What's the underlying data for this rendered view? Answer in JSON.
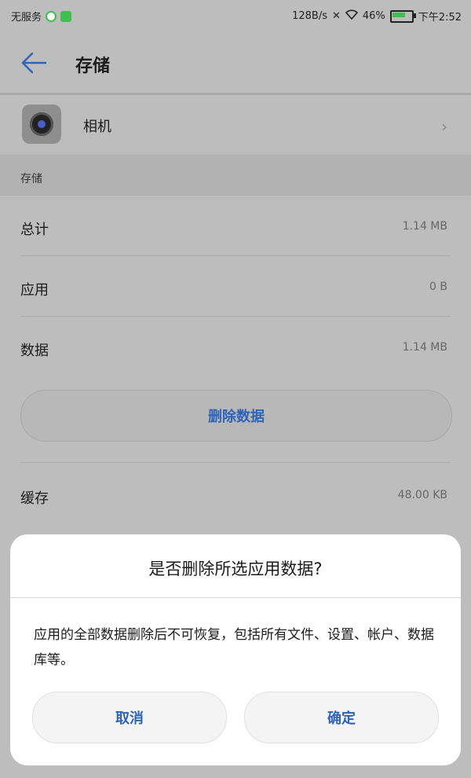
{
  "status_bar": {
    "carrier": "无服务",
    "speed": "128B/s",
    "battery_pct": "46%",
    "time": "下午2:52"
  },
  "header": {
    "title": "存储"
  },
  "app": {
    "name": "相机"
  },
  "storage": {
    "section_label": "存储",
    "rows": [
      {
        "label": "总计",
        "value": "1.14 MB"
      },
      {
        "label": "应用",
        "value": "0 B"
      },
      {
        "label": "数据",
        "value": "1.14 MB"
      }
    ],
    "delete_button": "删除数据",
    "cache_label": "缓存",
    "cache_value": "48.00 KB"
  },
  "dialog": {
    "title": "是否删除所选应用数据?",
    "message": "应用的全部数据删除后不可恢复，包括所有文件、设置、帐户、数据库等。",
    "cancel": "取消",
    "confirm": "确定"
  }
}
